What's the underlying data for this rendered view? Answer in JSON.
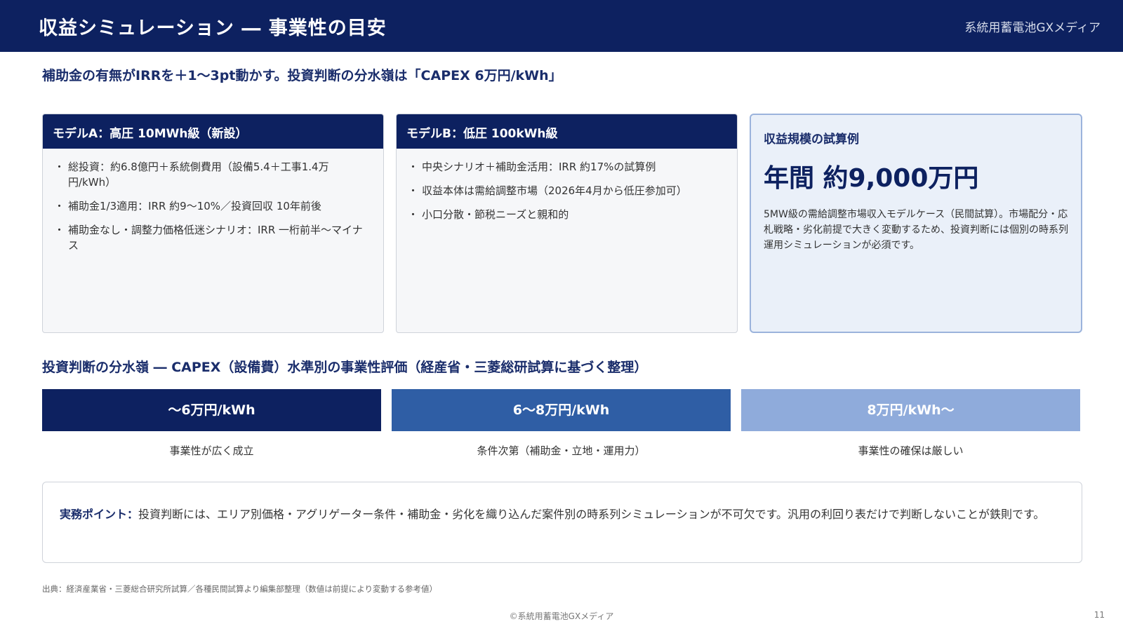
{
  "header": {
    "title": "収益シミュレーション ― 事業性の目安",
    "brand": "系統用蓄電池GXメディア"
  },
  "lead": "補助金の有無がIRRを＋1〜3pt動かす。投資判断の分水嶺は「CAPEX 6万円/kWh」",
  "model_a": {
    "title": "モデルA：高圧 10MWh級（新設）",
    "bullets": [
      "総投資：約6.8億円＋系統側費用（設備5.4＋工事1.4万円/kWh）",
      "補助金1/3適用：IRR 約9〜10%／投資回収 10年前後",
      "補助金なし・調整力価格低迷シナリオ：IRR 一桁前半〜マイナス"
    ]
  },
  "model_b": {
    "title": "モデルB：低圧 100kWh級",
    "bullets": [
      "中央シナリオ＋補助金活用：IRR 約17%の試算例",
      "収益本体は需給調整市場（2026年4月から低圧参加可）",
      "小口分散・節税ニーズと親和的"
    ]
  },
  "revenue": {
    "label": "収益規模の試算例",
    "value": "年間 約9,000万円",
    "description": "5MW級の需給調整市場収入モデルケース（民間試算）。市場配分・応札戦略・劣化前提で大きく変動するため、投資判断には個別の時系列運用シミュレーションが必須です。"
  },
  "section_title": "投資判断の分水嶺 ― CAPEX（設備費）水準別の事業性評価（経産省・三菱総研試算に基づく整理）",
  "tiers": [
    {
      "label": "〜6万円/kWh",
      "caption": "事業性が広く成立",
      "color": "#0d2160"
    },
    {
      "label": "6〜8万円/kWh",
      "caption": "条件次第（補助金・立地・運用力）",
      "color": "#2f5ea5"
    },
    {
      "label": "8万円/kWh〜",
      "caption": "事業性の確保は厳しい",
      "color": "#8fabdb"
    }
  ],
  "note": {
    "label": "実務ポイント：",
    "text": "投資判断には、エリア別価格・アグリゲーター条件・補助金・劣化を織り込んだ案件別の時系列シミュレーションが不可欠です。汎用の利回り表だけで判断しないことが鉄則です。"
  },
  "source": "出典：経済産業省・三菱総合研究所試算／各種民間試算より編集部整理（数値は前提により変動する参考値）",
  "footer": "©系統用蓄電池GXメディア",
  "page_number": "11"
}
